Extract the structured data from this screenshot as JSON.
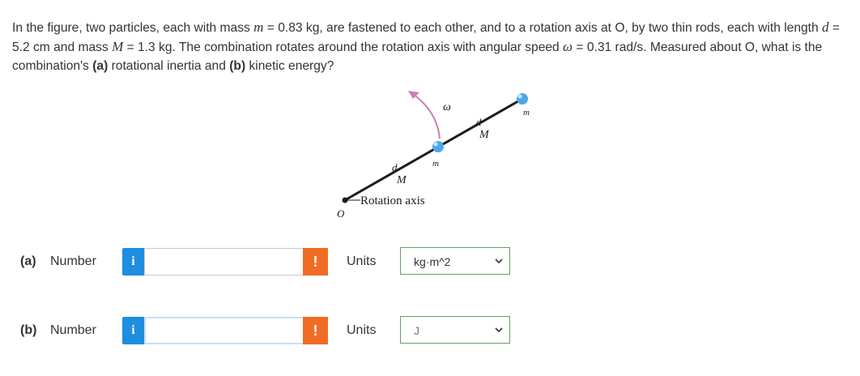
{
  "question": {
    "t1": "In the figure, two particles, each with mass ",
    "m_sym": "m",
    "t2": " = 0.83 kg, are fastened to each other, and to a rotation axis at O, by two thin rods, each with length ",
    "d_sym": "d",
    "t3": " = 5.2 cm and mass ",
    "M_sym": "M",
    "t4": " = 1.3 kg. The combination rotates around the rotation axis with angular speed ",
    "w_sym": "ω",
    "t5": " = 0.31 rad/s. Measured about O, what is the combination's ",
    "part_a": "(a)",
    "t6": " rotational inertia and ",
    "part_b": "(b)",
    "t7": " kinetic energy?"
  },
  "figure": {
    "omega": "ω",
    "m_upper": "m",
    "d_upper": "d",
    "M_upper": "M",
    "m_lower": "m",
    "d_lower": "d",
    "M_lower": "M",
    "axis_label": "Rotation axis",
    "origin": "O",
    "rod_color": "#1a1a1a",
    "particle_color": "#4aa8e8",
    "arrow_color": "#c97fb0"
  },
  "answers": [
    {
      "part": "(a)",
      "label": "Number",
      "info": "i",
      "value": "",
      "warn": "!",
      "units_label": "Units",
      "units_value": "kg·m^2"
    },
    {
      "part": "(b)",
      "label": "Number",
      "info": "i",
      "value": "",
      "warn": "!",
      "units_label": "Units",
      "units_value": "J"
    }
  ],
  "colors": {
    "info": "#1f8de0",
    "warn": "#f06c25",
    "select_border": "#6b9b6b"
  }
}
